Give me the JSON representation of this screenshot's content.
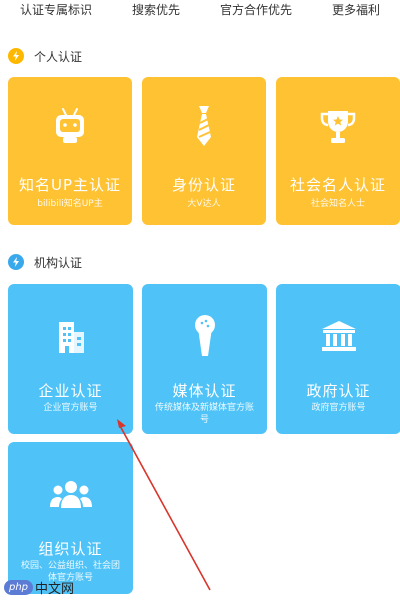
{
  "tabs": [
    "认证专属标识",
    "搜索优先",
    "官方合作优先",
    "更多福利"
  ],
  "sections": {
    "personal": {
      "title": "个人认证",
      "icon": "lightning-icon",
      "color": "#FFB800"
    },
    "org": {
      "title": "机构认证",
      "icon": "lightning-icon",
      "color": "#39A9EC"
    }
  },
  "personal_cards": [
    {
      "title": "知名UP主认证",
      "sub": "bilibili知名UP主",
      "icon": "tv-robot-icon"
    },
    {
      "title": "身份认证",
      "sub": "大V达人",
      "icon": "necktie-icon"
    },
    {
      "title": "社会名人认证",
      "sub": "社会知名人士",
      "icon": "trophy-icon"
    }
  ],
  "org_cards": [
    {
      "title": "企业认证",
      "sub": "企业官方账号",
      "icon": "building-icon"
    },
    {
      "title": "媒体认证",
      "sub": "传统媒体及新媒体官方账号",
      "icon": "microphone-icon"
    },
    {
      "title": "政府认证",
      "sub": "政府官方账号",
      "icon": "government-icon"
    },
    {
      "title": "组织认证",
      "sub": "校园、公益组织、社会团体官方账号",
      "icon": "group-icon"
    }
  ],
  "watermark": {
    "badge": "php",
    "text": "中文网"
  },
  "colors": {
    "yellow_card": "#FFC233",
    "blue_card": "#4FC3F7",
    "arrow": "#D9352B"
  }
}
